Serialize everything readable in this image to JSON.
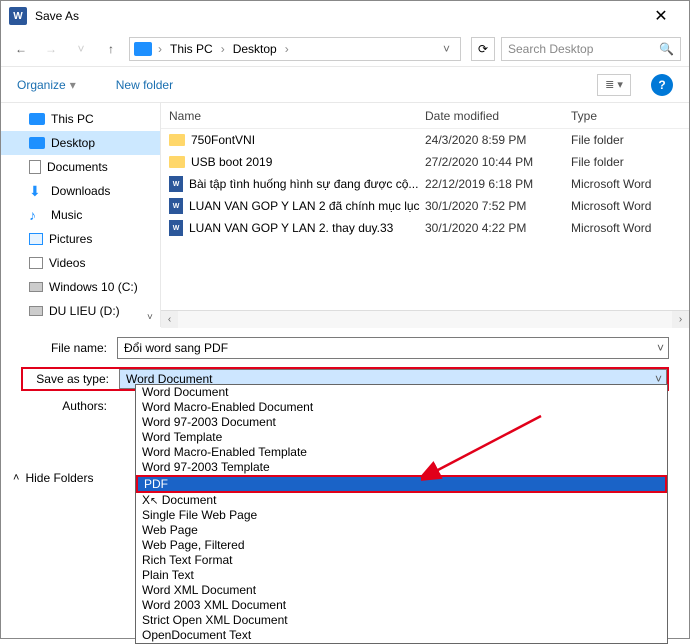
{
  "titlebar": {
    "title": "Save As"
  },
  "breadcrumb": {
    "pc": "This PC",
    "desktop": "Desktop"
  },
  "search": {
    "placeholder": "Search Desktop"
  },
  "toolbar": {
    "organize": "Organize",
    "newfolder": "New folder"
  },
  "sidebar": {
    "items": [
      {
        "label": "This PC",
        "icon": "monitor",
        "selected": false
      },
      {
        "label": "Desktop",
        "icon": "desktop",
        "selected": true
      },
      {
        "label": "Documents",
        "icon": "doc",
        "selected": false
      },
      {
        "label": "Downloads",
        "icon": "dl",
        "selected": false
      },
      {
        "label": "Music",
        "icon": "music",
        "selected": false
      },
      {
        "label": "Pictures",
        "icon": "pic",
        "selected": false
      },
      {
        "label": "Videos",
        "icon": "vid",
        "selected": false
      },
      {
        "label": "Windows 10 (C:)",
        "icon": "disk",
        "selected": false
      },
      {
        "label": "DU LIEU (D:)",
        "icon": "disk",
        "selected": false
      }
    ]
  },
  "columns": {
    "name": "Name",
    "date": "Date modified",
    "type": "Type"
  },
  "files": [
    {
      "name": "750FontVNI",
      "date": "24/3/2020 8:59 PM",
      "type": "File folder",
      "icon": "folder"
    },
    {
      "name": "USB boot 2019",
      "date": "27/2/2020 10:44 PM",
      "type": "File folder",
      "icon": "folder"
    },
    {
      "name": "Bài tập tình huống hình sự đang được cộ...",
      "date": "22/12/2019 6:18 PM",
      "type": "Microsoft Word",
      "icon": "word"
    },
    {
      "name": "LUAN VAN GOP Y LAN 2 đã chính mục lục",
      "date": "30/1/2020 7:52 PM",
      "type": "Microsoft Word",
      "icon": "word"
    },
    {
      "name": "LUAN VAN GOP Y LAN 2. thay duy.33",
      "date": "30/1/2020 4:22 PM",
      "type": "Microsoft Word",
      "icon": "word"
    }
  ],
  "form": {
    "filename_label": "File name:",
    "filename_value": "Đổi word sang PDF",
    "savetype_label": "Save as type:",
    "savetype_value": "Word Document",
    "authors_label": "Authors:"
  },
  "dropdown_items": [
    "Word Document",
    "Word Macro-Enabled Document",
    "Word 97-2003 Document",
    "Word Template",
    "Word Macro-Enabled Template",
    "Word 97-2003 Template",
    "PDF",
    "XPS Document",
    "Single File Web Page",
    "Web Page",
    "Web Page, Filtered",
    "Rich Text Format",
    "Plain Text",
    "Word XML Document",
    "Word 2003 XML Document",
    "Strict Open XML Document",
    "OpenDocument Text"
  ],
  "dropdown_selected_index": 6,
  "hide_folders": "Hide Folders"
}
